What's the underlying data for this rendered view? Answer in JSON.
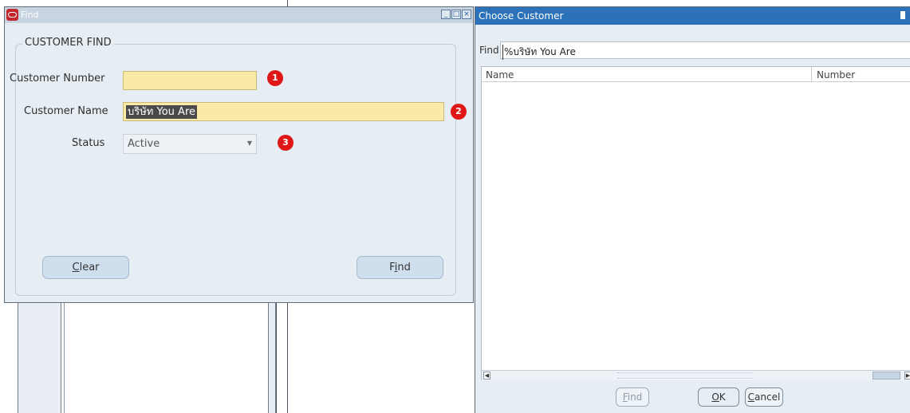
{
  "find_window": {
    "title": "Find",
    "win_buttons": [
      "_",
      "□",
      "×"
    ],
    "group_title": "CUSTOMER FIND",
    "labels": {
      "customer_number": "Customer Number",
      "customer_name": "Customer Name",
      "status": "Status"
    },
    "fields": {
      "customer_number": "",
      "customer_name": "บริษัท You Are",
      "status": "Active"
    },
    "badges": [
      "1",
      "2",
      "3"
    ],
    "buttons": {
      "clear_prefix": "",
      "clear_key": "C",
      "clear_rest": "lear",
      "find_prefix": "F",
      "find_key": "i",
      "find_rest": "nd"
    },
    "badge_color": "#e01717",
    "field_color": "#fbe9a8"
  },
  "choose_window": {
    "title": "Choose Customer",
    "find_label": "Find",
    "find_value": "%บริษัท You Are",
    "columns": [
      "Name",
      "Number"
    ],
    "rows": [],
    "buttons": {
      "find_key": "F",
      "find_rest": "ind",
      "ok_key": "O",
      "ok_rest": "K",
      "cancel_key": "C",
      "cancel_rest": "ancel"
    },
    "titlebar_color": "#2c72b8"
  }
}
